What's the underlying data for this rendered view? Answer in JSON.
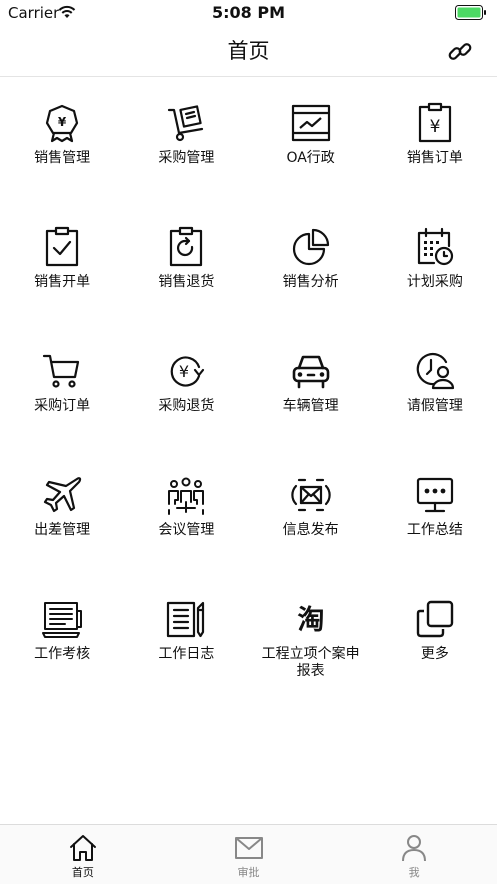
{
  "status_bar": {
    "carrier": "Carrier",
    "time": "5:08 PM"
  },
  "nav": {
    "title": "首页",
    "link_icon": "link-icon"
  },
  "grid": [
    {
      "label": "销售管理",
      "icon": "yen-badge-icon"
    },
    {
      "label": "采购管理",
      "icon": "hand-truck-icon"
    },
    {
      "label": "OA行政",
      "icon": "chart-window-icon"
    },
    {
      "label": "销售订单",
      "icon": "yen-clipboard-icon"
    },
    {
      "label": "销售开单",
      "icon": "check-clipboard-icon"
    },
    {
      "label": "销售退货",
      "icon": "return-clipboard-icon"
    },
    {
      "label": "销售分析",
      "icon": "pie-chart-icon"
    },
    {
      "label": "计划采购",
      "icon": "calendar-clock-icon"
    },
    {
      "label": "采购订单",
      "icon": "shopping-cart-icon"
    },
    {
      "label": "采购退货",
      "icon": "yen-refund-icon"
    },
    {
      "label": "车辆管理",
      "icon": "car-icon"
    },
    {
      "label": "请假管理",
      "icon": "clock-person-icon"
    },
    {
      "label": "出差管理",
      "icon": "airplane-icon"
    },
    {
      "label": "会议管理",
      "icon": "meeting-icon"
    },
    {
      "label": "信息发布",
      "icon": "broadcast-mail-icon"
    },
    {
      "label": "工作总结",
      "icon": "chat-monitor-icon"
    },
    {
      "label": "工作考核",
      "icon": "computer-icon"
    },
    {
      "label": "工作日志",
      "icon": "notebook-pencil-icon"
    },
    {
      "label": "工程立项个案申报表",
      "icon": "taobao-icon",
      "icon_text": "淘"
    },
    {
      "label": "更多",
      "icon": "copy-squares-icon"
    }
  ],
  "tabs": [
    {
      "label": "首页",
      "icon": "home-icon",
      "active": true
    },
    {
      "label": "审批",
      "icon": "mail-icon",
      "active": false
    },
    {
      "label": "我",
      "icon": "user-icon",
      "active": false
    }
  ]
}
